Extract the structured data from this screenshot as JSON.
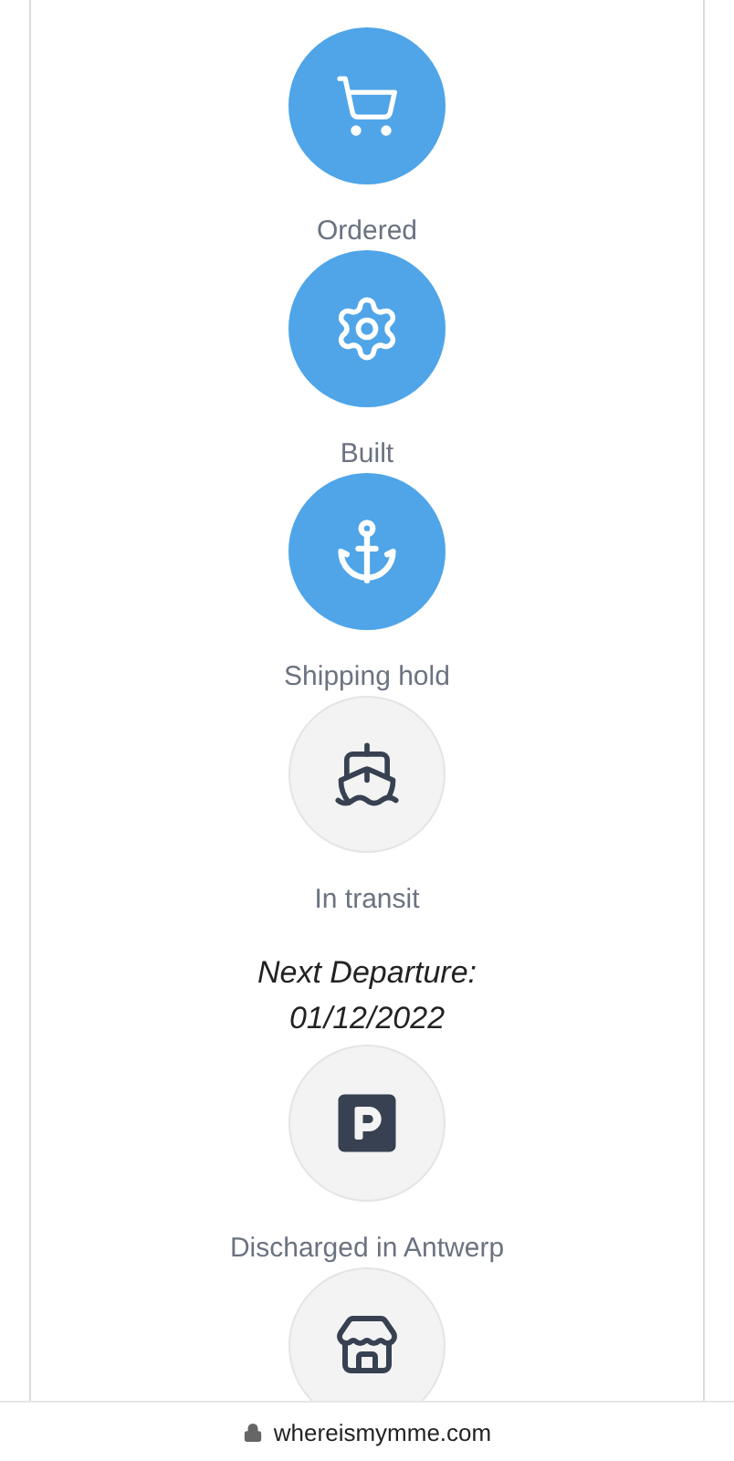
{
  "steps": [
    {
      "kind": "cart",
      "label": "Ordered",
      "done": true
    },
    {
      "kind": "gear",
      "label": "Built",
      "done": true
    },
    {
      "kind": "anchor",
      "label": "Shipping hold",
      "done": true
    },
    {
      "kind": "ship",
      "label": "In transit",
      "done": false,
      "note": [
        "Next Departure:",
        "01/12/2022"
      ]
    },
    {
      "kind": "parking",
      "label": "Discharged in Antwerp",
      "done": false
    },
    {
      "kind": "store",
      "done": false
    }
  ],
  "address_bar": {
    "url": "whereismymme.com"
  }
}
